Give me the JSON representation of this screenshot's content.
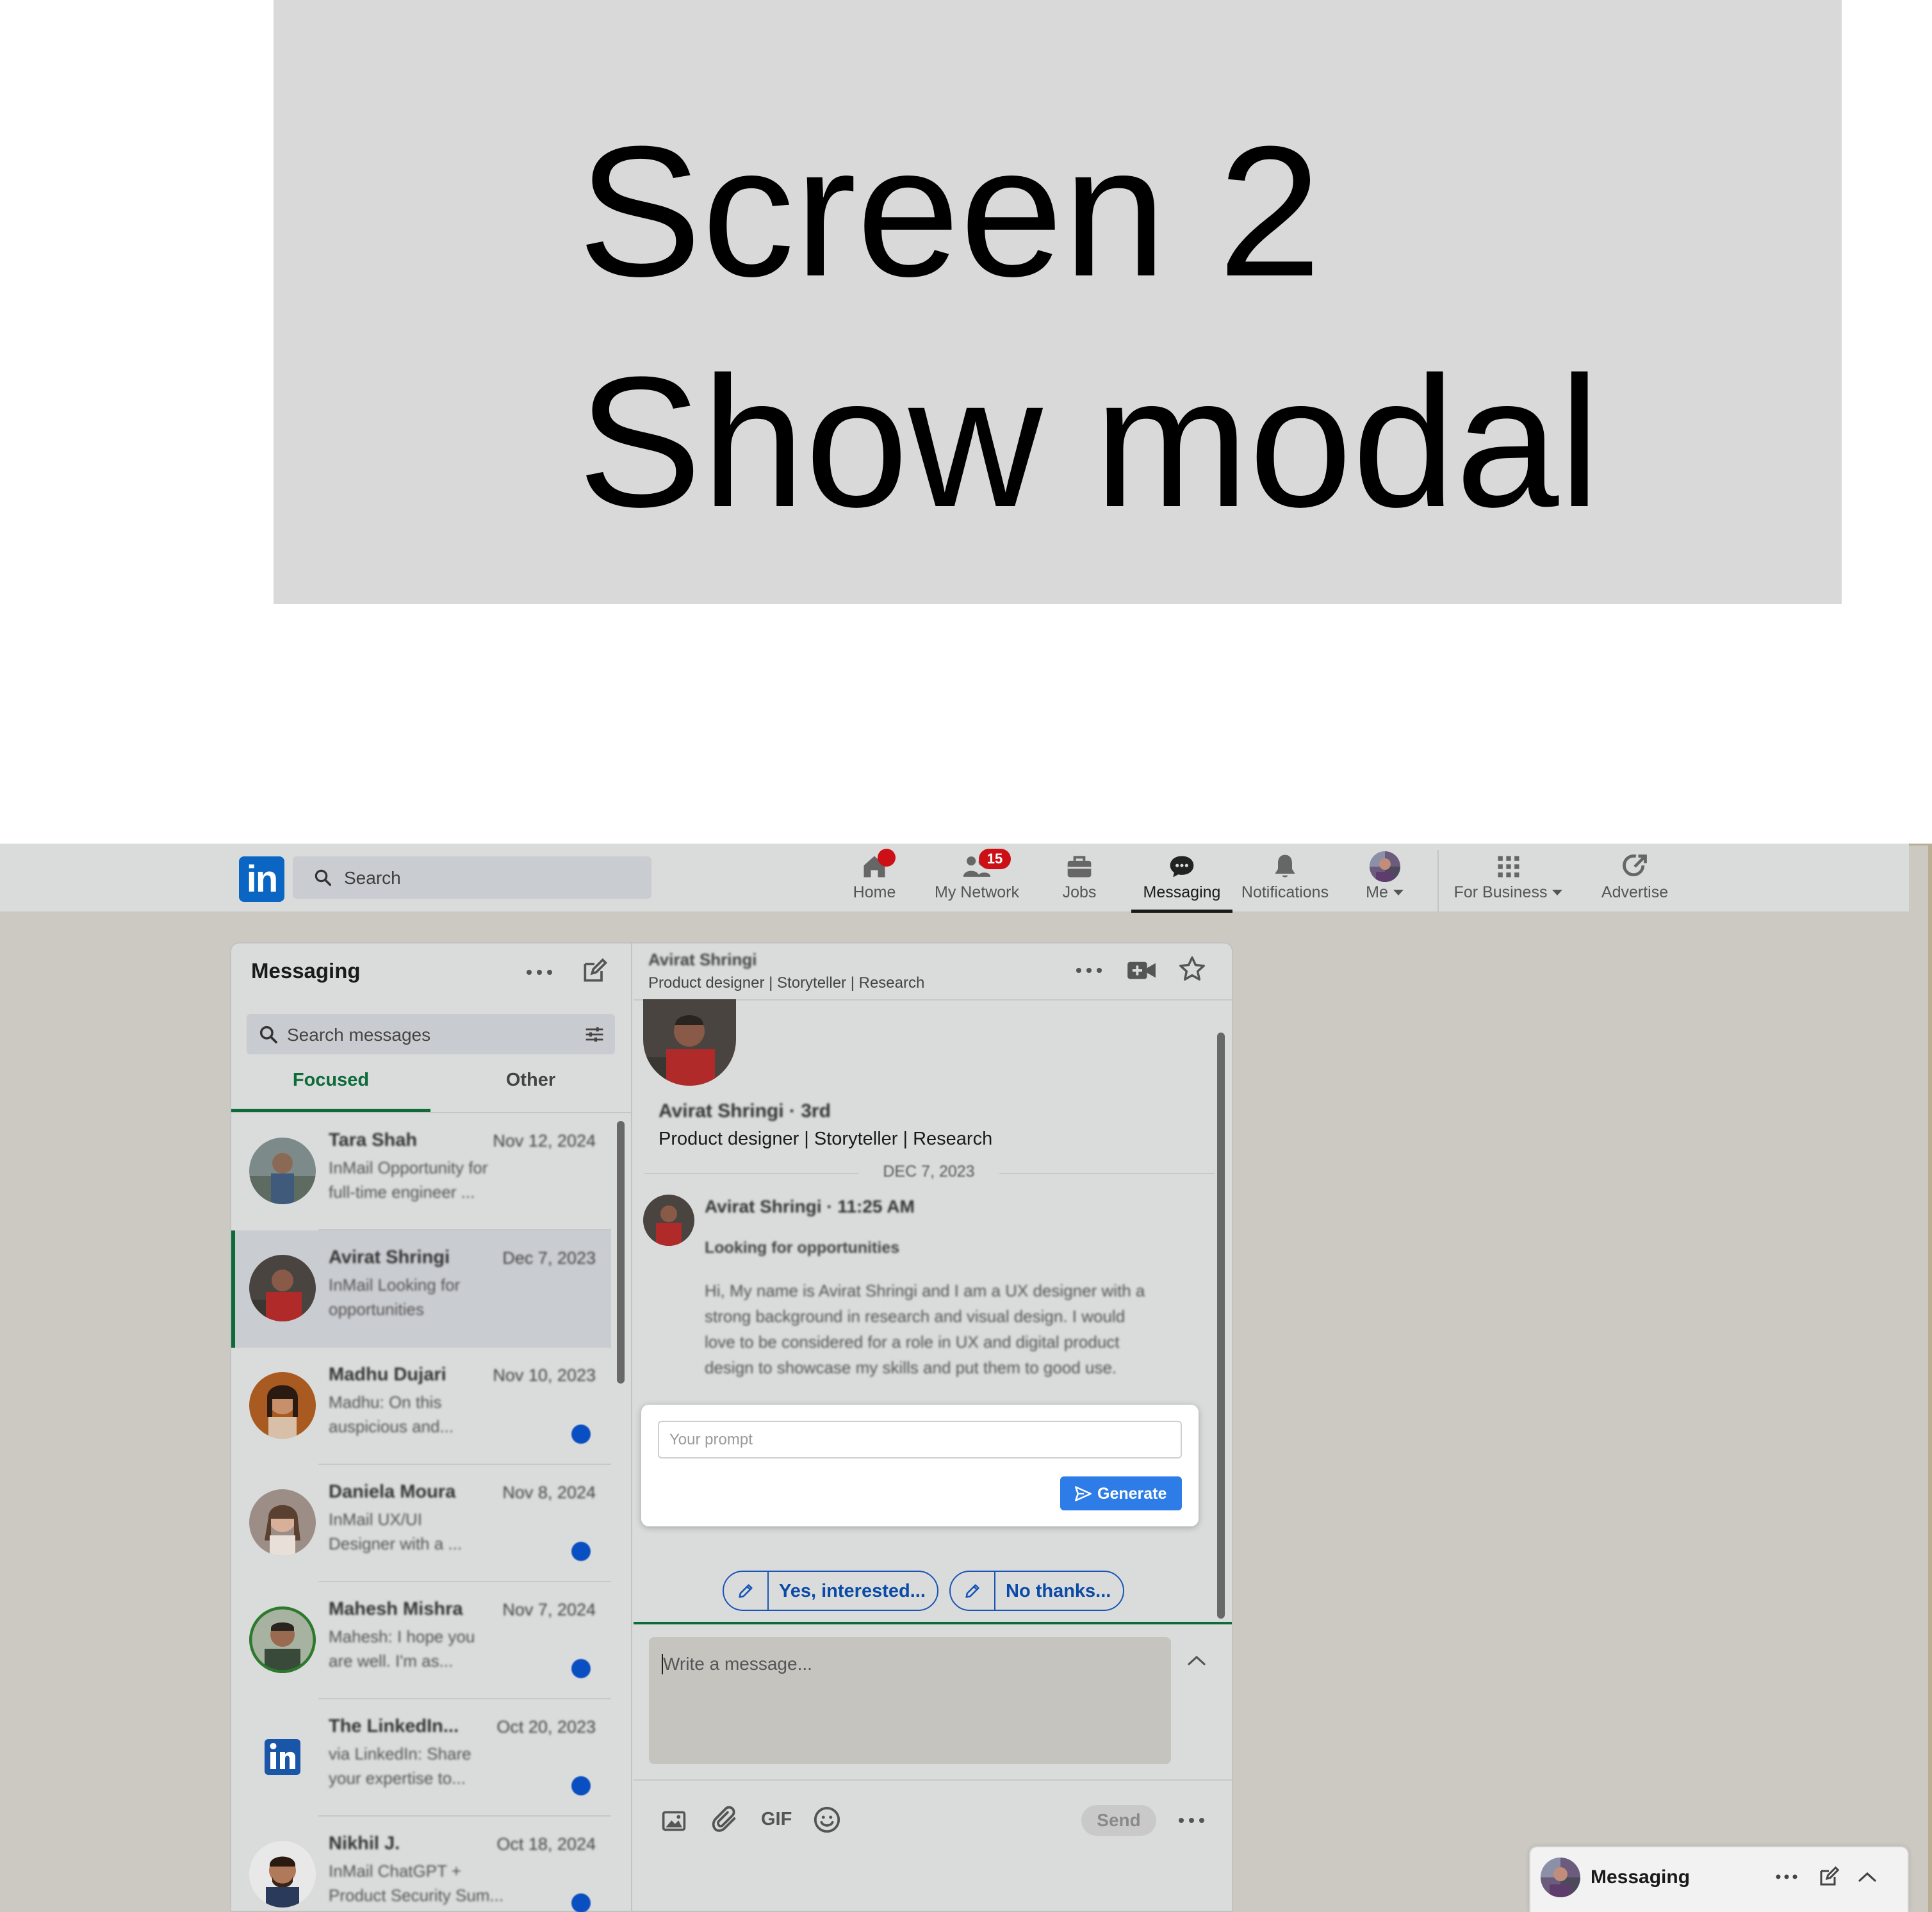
{
  "banner": {
    "line1": "Screen 2",
    "line2": "Show modal"
  },
  "topnav": {
    "logo": "in",
    "search_placeholder": "Search",
    "items": [
      {
        "label": "Home",
        "icon": "home-icon",
        "badge": ""
      },
      {
        "label": "My Network",
        "icon": "network-icon",
        "badge": "15"
      },
      {
        "label": "Jobs",
        "icon": "briefcase-icon",
        "badge": ""
      },
      {
        "label": "Messaging",
        "icon": "messaging-icon",
        "badge": "",
        "active": true
      },
      {
        "label": "Notifications",
        "icon": "bell-icon",
        "badge": ""
      },
      {
        "label": "Me",
        "icon": "avatar",
        "badge": ""
      },
      {
        "label": "For Business",
        "icon": "grid-icon",
        "badge": ""
      },
      {
        "label": "Advertise",
        "icon": "advertise-icon",
        "badge": ""
      }
    ]
  },
  "messaging": {
    "title": "Messaging",
    "search_placeholder": "Search messages",
    "tabs": [
      {
        "label": "Focused",
        "active": true
      },
      {
        "label": "Other",
        "active": false
      }
    ],
    "conversations": [
      {
        "name": "Tara Shah",
        "date": "Nov 12, 2024",
        "line2": "InMail  Opportunity for",
        "line3": "full-time engineer ...",
        "unread": false,
        "selected": false
      },
      {
        "name": "Avirat Shringi",
        "date": "Dec 7, 2023",
        "line2": "InMail  Looking for",
        "line3": "opportunities",
        "unread": false,
        "selected": true
      },
      {
        "name": "Madhu Dujari",
        "date": "Nov 10, 2023",
        "line2": "Madhu: On this",
        "line3": "auspicious and...",
        "unread": true,
        "selected": false
      },
      {
        "name": "Daniela Moura",
        "date": "Nov 8, 2024",
        "line2": "InMail  UX/UI",
        "line3": "Designer with a ...",
        "unread": true,
        "selected": false
      },
      {
        "name": "Mahesh Mishra",
        "date": "Nov 7, 2024",
        "line2": "Mahesh: I hope you",
        "line3": "are well. I'm as...",
        "unread": true,
        "selected": false
      },
      {
        "name": "The LinkedIn...",
        "date": "Oct 20, 2023",
        "line2": "via LinkedIn: Share",
        "line3": "your expertise to...",
        "unread": true,
        "selected": false
      },
      {
        "name": "Nikhil J.",
        "date": "Oct 18, 2024",
        "line2": "InMail  ChatGPT +",
        "line3": "Product Security Sum...",
        "unread": true,
        "selected": false
      }
    ]
  },
  "chat": {
    "header_name": "Avirat Shringi",
    "header_sub": "Product designer | Storyteller | Research",
    "profile_name": "Avirat Shringi · 3rd",
    "profile_sub": "Product designer | Storyteller | Research",
    "date_separator": "DEC 7, 2023",
    "message": {
      "author": "Avirat Shringi · 11:25 AM",
      "subject": "Looking for opportunities",
      "body": "Hi, My name is Avirat Shringi and I am a UX designer with a strong background in research and visual design. I would love to be considered for a role in UX and digital product design to showcase my skills and put them to good use."
    },
    "modal": {
      "prompt_placeholder": "Your prompt",
      "generate_label": "Generate"
    },
    "replies": [
      "Yes, interested...",
      "No thanks..."
    ],
    "compose_placeholder": "Write a message...",
    "gif_label": "GIF",
    "send_label": "Send"
  },
  "dock": {
    "title": "Messaging"
  },
  "colors": {
    "linkedin_blue": "#0a66c2",
    "focused_green": "#0d6b3a",
    "generate_blue": "#2d7ce8",
    "badge_red": "#cc1016"
  }
}
